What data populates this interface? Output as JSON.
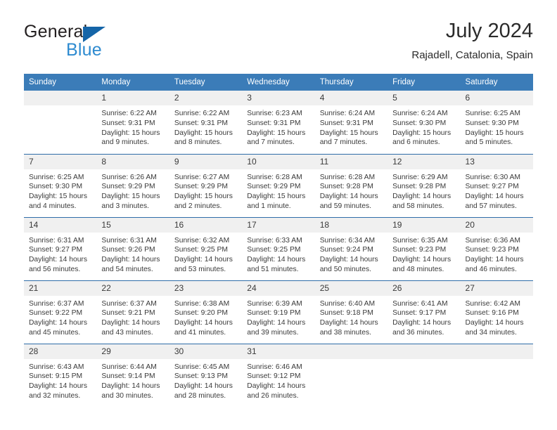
{
  "brand": {
    "name_part1": "General",
    "name_part2": "Blue",
    "triangle_icon": "triangle-icon",
    "accent_color": "#2e8bd0",
    "dark_color": "#231f20"
  },
  "header": {
    "title": "July 2024",
    "subtitle": "Rajadell, Catalonia, Spain"
  },
  "calendar": {
    "header_bg": "#3b7cb8",
    "row_divider_color": "#2f6da8",
    "daynum_bg": "#f0f0f0",
    "weekdays": [
      "Sunday",
      "Monday",
      "Tuesday",
      "Wednesday",
      "Thursday",
      "Friday",
      "Saturday"
    ],
    "weeks": [
      [
        {
          "day": "",
          "sunrise": "",
          "sunset": "",
          "daylight_line1": "",
          "daylight_line2": ""
        },
        {
          "day": "1",
          "sunrise": "Sunrise: 6:22 AM",
          "sunset": "Sunset: 9:31 PM",
          "daylight_line1": "Daylight: 15 hours",
          "daylight_line2": "and 9 minutes."
        },
        {
          "day": "2",
          "sunrise": "Sunrise: 6:22 AM",
          "sunset": "Sunset: 9:31 PM",
          "daylight_line1": "Daylight: 15 hours",
          "daylight_line2": "and 8 minutes."
        },
        {
          "day": "3",
          "sunrise": "Sunrise: 6:23 AM",
          "sunset": "Sunset: 9:31 PM",
          "daylight_line1": "Daylight: 15 hours",
          "daylight_line2": "and 7 minutes."
        },
        {
          "day": "4",
          "sunrise": "Sunrise: 6:24 AM",
          "sunset": "Sunset: 9:31 PM",
          "daylight_line1": "Daylight: 15 hours",
          "daylight_line2": "and 7 minutes."
        },
        {
          "day": "5",
          "sunrise": "Sunrise: 6:24 AM",
          "sunset": "Sunset: 9:30 PM",
          "daylight_line1": "Daylight: 15 hours",
          "daylight_line2": "and 6 minutes."
        },
        {
          "day": "6",
          "sunrise": "Sunrise: 6:25 AM",
          "sunset": "Sunset: 9:30 PM",
          "daylight_line1": "Daylight: 15 hours",
          "daylight_line2": "and 5 minutes."
        }
      ],
      [
        {
          "day": "7",
          "sunrise": "Sunrise: 6:25 AM",
          "sunset": "Sunset: 9:30 PM",
          "daylight_line1": "Daylight: 15 hours",
          "daylight_line2": "and 4 minutes."
        },
        {
          "day": "8",
          "sunrise": "Sunrise: 6:26 AM",
          "sunset": "Sunset: 9:29 PM",
          "daylight_line1": "Daylight: 15 hours",
          "daylight_line2": "and 3 minutes."
        },
        {
          "day": "9",
          "sunrise": "Sunrise: 6:27 AM",
          "sunset": "Sunset: 9:29 PM",
          "daylight_line1": "Daylight: 15 hours",
          "daylight_line2": "and 2 minutes."
        },
        {
          "day": "10",
          "sunrise": "Sunrise: 6:28 AM",
          "sunset": "Sunset: 9:29 PM",
          "daylight_line1": "Daylight: 15 hours",
          "daylight_line2": "and 1 minute."
        },
        {
          "day": "11",
          "sunrise": "Sunrise: 6:28 AM",
          "sunset": "Sunset: 9:28 PM",
          "daylight_line1": "Daylight: 14 hours",
          "daylight_line2": "and 59 minutes."
        },
        {
          "day": "12",
          "sunrise": "Sunrise: 6:29 AM",
          "sunset": "Sunset: 9:28 PM",
          "daylight_line1": "Daylight: 14 hours",
          "daylight_line2": "and 58 minutes."
        },
        {
          "day": "13",
          "sunrise": "Sunrise: 6:30 AM",
          "sunset": "Sunset: 9:27 PM",
          "daylight_line1": "Daylight: 14 hours",
          "daylight_line2": "and 57 minutes."
        }
      ],
      [
        {
          "day": "14",
          "sunrise": "Sunrise: 6:31 AM",
          "sunset": "Sunset: 9:27 PM",
          "daylight_line1": "Daylight: 14 hours",
          "daylight_line2": "and 56 minutes."
        },
        {
          "day": "15",
          "sunrise": "Sunrise: 6:31 AM",
          "sunset": "Sunset: 9:26 PM",
          "daylight_line1": "Daylight: 14 hours",
          "daylight_line2": "and 54 minutes."
        },
        {
          "day": "16",
          "sunrise": "Sunrise: 6:32 AM",
          "sunset": "Sunset: 9:25 PM",
          "daylight_line1": "Daylight: 14 hours",
          "daylight_line2": "and 53 minutes."
        },
        {
          "day": "17",
          "sunrise": "Sunrise: 6:33 AM",
          "sunset": "Sunset: 9:25 PM",
          "daylight_line1": "Daylight: 14 hours",
          "daylight_line2": "and 51 minutes."
        },
        {
          "day": "18",
          "sunrise": "Sunrise: 6:34 AM",
          "sunset": "Sunset: 9:24 PM",
          "daylight_line1": "Daylight: 14 hours",
          "daylight_line2": "and 50 minutes."
        },
        {
          "day": "19",
          "sunrise": "Sunrise: 6:35 AM",
          "sunset": "Sunset: 9:23 PM",
          "daylight_line1": "Daylight: 14 hours",
          "daylight_line2": "and 48 minutes."
        },
        {
          "day": "20",
          "sunrise": "Sunrise: 6:36 AM",
          "sunset": "Sunset: 9:23 PM",
          "daylight_line1": "Daylight: 14 hours",
          "daylight_line2": "and 46 minutes."
        }
      ],
      [
        {
          "day": "21",
          "sunrise": "Sunrise: 6:37 AM",
          "sunset": "Sunset: 9:22 PM",
          "daylight_line1": "Daylight: 14 hours",
          "daylight_line2": "and 45 minutes."
        },
        {
          "day": "22",
          "sunrise": "Sunrise: 6:37 AM",
          "sunset": "Sunset: 9:21 PM",
          "daylight_line1": "Daylight: 14 hours",
          "daylight_line2": "and 43 minutes."
        },
        {
          "day": "23",
          "sunrise": "Sunrise: 6:38 AM",
          "sunset": "Sunset: 9:20 PM",
          "daylight_line1": "Daylight: 14 hours",
          "daylight_line2": "and 41 minutes."
        },
        {
          "day": "24",
          "sunrise": "Sunrise: 6:39 AM",
          "sunset": "Sunset: 9:19 PM",
          "daylight_line1": "Daylight: 14 hours",
          "daylight_line2": "and 39 minutes."
        },
        {
          "day": "25",
          "sunrise": "Sunrise: 6:40 AM",
          "sunset": "Sunset: 9:18 PM",
          "daylight_line1": "Daylight: 14 hours",
          "daylight_line2": "and 38 minutes."
        },
        {
          "day": "26",
          "sunrise": "Sunrise: 6:41 AM",
          "sunset": "Sunset: 9:17 PM",
          "daylight_line1": "Daylight: 14 hours",
          "daylight_line2": "and 36 minutes."
        },
        {
          "day": "27",
          "sunrise": "Sunrise: 6:42 AM",
          "sunset": "Sunset: 9:16 PM",
          "daylight_line1": "Daylight: 14 hours",
          "daylight_line2": "and 34 minutes."
        }
      ],
      [
        {
          "day": "28",
          "sunrise": "Sunrise: 6:43 AM",
          "sunset": "Sunset: 9:15 PM",
          "daylight_line1": "Daylight: 14 hours",
          "daylight_line2": "and 32 minutes."
        },
        {
          "day": "29",
          "sunrise": "Sunrise: 6:44 AM",
          "sunset": "Sunset: 9:14 PM",
          "daylight_line1": "Daylight: 14 hours",
          "daylight_line2": "and 30 minutes."
        },
        {
          "day": "30",
          "sunrise": "Sunrise: 6:45 AM",
          "sunset": "Sunset: 9:13 PM",
          "daylight_line1": "Daylight: 14 hours",
          "daylight_line2": "and 28 minutes."
        },
        {
          "day": "31",
          "sunrise": "Sunrise: 6:46 AM",
          "sunset": "Sunset: 9:12 PM",
          "daylight_line1": "Daylight: 14 hours",
          "daylight_line2": "and 26 minutes."
        },
        {
          "day": "",
          "sunrise": "",
          "sunset": "",
          "daylight_line1": "",
          "daylight_line2": ""
        },
        {
          "day": "",
          "sunrise": "",
          "sunset": "",
          "daylight_line1": "",
          "daylight_line2": ""
        },
        {
          "day": "",
          "sunrise": "",
          "sunset": "",
          "daylight_line1": "",
          "daylight_line2": ""
        }
      ]
    ]
  }
}
